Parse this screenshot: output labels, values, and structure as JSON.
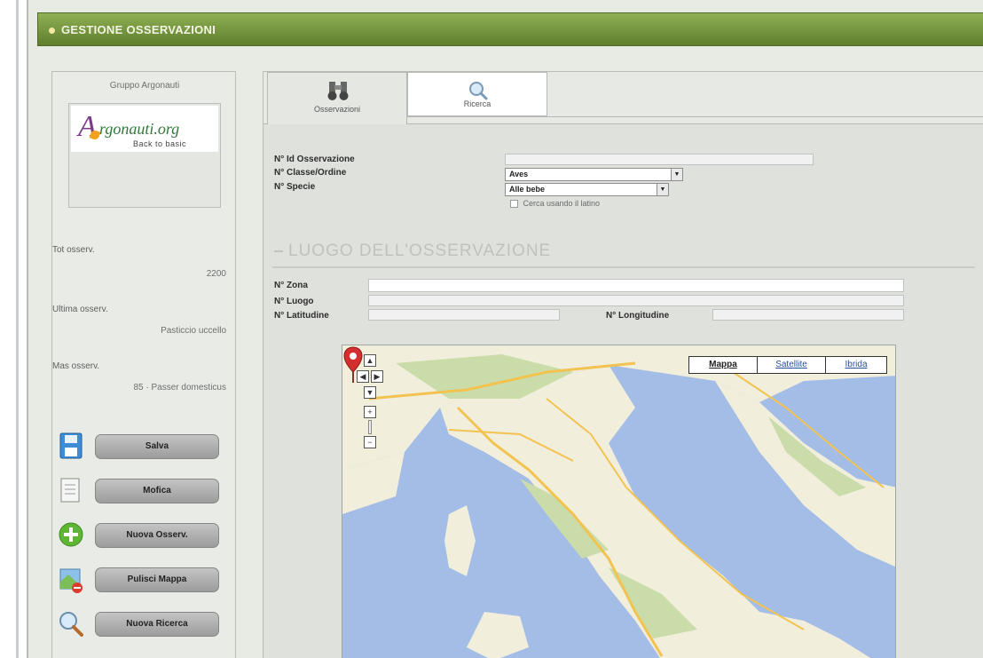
{
  "header": {
    "title": "GESTIONE OSSERVAZIONI"
  },
  "sidebar": {
    "group_title": "Gruppo Argonauti",
    "logo": {
      "word": "rgonauti.org",
      "letter": "A",
      "subtitle": "Back to basic"
    },
    "stats": [
      {
        "label": "Tot osserv.",
        "value": "2200"
      },
      {
        "label": "Ultima osserv.",
        "value": "Pasticcio uccello"
      },
      {
        "label": "Mas osserv.",
        "value": "85 · Passer domesticus"
      }
    ],
    "actions": [
      {
        "label": "Salva",
        "icon": "floppy-disk-icon"
      },
      {
        "label": "Mofica",
        "icon": "edit-document-icon"
      },
      {
        "label": "Nuova Osserv.",
        "icon": "add-circle-icon"
      },
      {
        "label": "Pulisci Mappa",
        "icon": "clear-map-icon"
      },
      {
        "label": "Nuova Ricerca",
        "icon": "search-magnifier-icon"
      }
    ]
  },
  "tabs": [
    {
      "label": "Osservazioni",
      "icon": "binoculars-icon",
      "active": true
    },
    {
      "label": "Ricerca",
      "icon": "magnifier-icon",
      "active": false
    }
  ],
  "form": {
    "fields": [
      {
        "label": "N° Id Osservazione",
        "value": ""
      },
      {
        "label": "N° Classe/Ordine",
        "value": "Aves"
      },
      {
        "label": "N° Specie",
        "value": "Alle bebe"
      }
    ],
    "checkbox_label": "Cerca usando il latino"
  },
  "location": {
    "section_title": "LUOGO DELL'OSSERVAZIONE",
    "fields": [
      {
        "label": "N° Zona",
        "value": ""
      },
      {
        "label": "N° Luogo",
        "value": ""
      },
      {
        "label": "N° Latitudine",
        "value": ""
      },
      {
        "label": "N° Longitudine",
        "value": ""
      }
    ]
  },
  "map": {
    "types": [
      "Mappa",
      "Satellite",
      "Ibrida"
    ],
    "selected_type": "Mappa",
    "marker_icon": "map-pin-icon",
    "zoom_controls": [
      "pan-up",
      "pan-left",
      "pan-right",
      "pan-down",
      "zoom-in",
      "zoom-out"
    ],
    "colors": {
      "sea": "#a4bde6",
      "land": "#f1eedc",
      "green": "#c9dcaa",
      "road": "#f2c350",
      "marker": "#d42e2e"
    }
  }
}
